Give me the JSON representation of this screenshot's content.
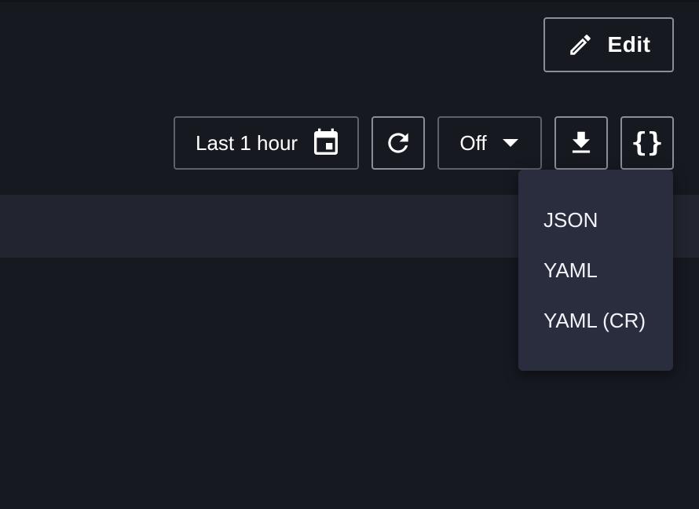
{
  "toolbar": {
    "edit_label": "Edit",
    "time_range_label": "Last 1 hour",
    "refresh_interval_label": "Off",
    "code_label": "{}"
  },
  "icons": {
    "edit": "pencil-icon",
    "time_range": "calendar-icon",
    "refresh": "refresh-icon",
    "interval": "caret-down-icon",
    "download": "download-icon"
  },
  "export_menu": {
    "items": [
      {
        "label": "JSON"
      },
      {
        "label": "YAML"
      },
      {
        "label": "YAML (CR)"
      }
    ]
  },
  "colors": {
    "background": "#171921",
    "panel": "#22252f",
    "menu": "#2a2d3d",
    "border": "#8a8e9a",
    "text": "#ffffff"
  }
}
